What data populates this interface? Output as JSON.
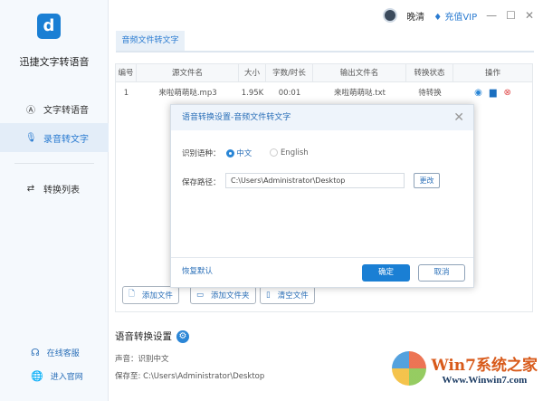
{
  "app": {
    "name": "迅捷文字转语音",
    "logo_letter": "d"
  },
  "sidebar": {
    "items": [
      {
        "label": "文字转语音",
        "icon": "text-a-icon"
      },
      {
        "label": "录音转文字",
        "icon": "microphone-icon",
        "active": true
      },
      {
        "label": "转换列表",
        "icon": "list-convert-icon"
      }
    ],
    "footer": [
      {
        "label": "在线客服",
        "icon": "headset-icon"
      },
      {
        "label": "进入官网",
        "icon": "globe-icon"
      }
    ]
  },
  "topbar": {
    "username": "晚清",
    "vip_label": "充值VIP"
  },
  "tabs": [
    {
      "label": "音频文件转文字",
      "active": true
    }
  ],
  "table": {
    "headers": [
      "编号",
      "源文件名",
      "大小",
      "字数/时长",
      "输出文件名",
      "转换状态",
      "操作"
    ],
    "rows": [
      {
        "index": "1",
        "source": "来啦萌萌哒.mp3",
        "size": "1.95K",
        "duration": "00:01",
        "output": "来啦萌萌哒.txt",
        "status": "待转换"
      }
    ]
  },
  "actions": {
    "add_file": "添加文件",
    "add_folder": "添加文件夹",
    "clear_files": "清空文件"
  },
  "settings": {
    "title": "语音转换设置",
    "voice_label": "声音：识别中文",
    "save_label": "保存至: C:\\Users\\Administrator\\Desktop"
  },
  "dialog": {
    "title": "语音转换设置-音频文件转文字",
    "lang_label": "识别语种：",
    "lang_options": [
      "中文",
      "English"
    ],
    "selected_lang": "中文",
    "path_label": "保存路径：",
    "path_value": "C:\\Users\\Administrator\\Desktop",
    "change_label": "更改",
    "reset_label": "恢复默认",
    "ok_label": "确定",
    "cancel_label": "取消"
  },
  "watermark": {
    "title": "Win7系统之家",
    "url": "Www.Winwin7.com"
  },
  "colors": {
    "accent": "#1a7fd4",
    "danger": "#e04848"
  }
}
